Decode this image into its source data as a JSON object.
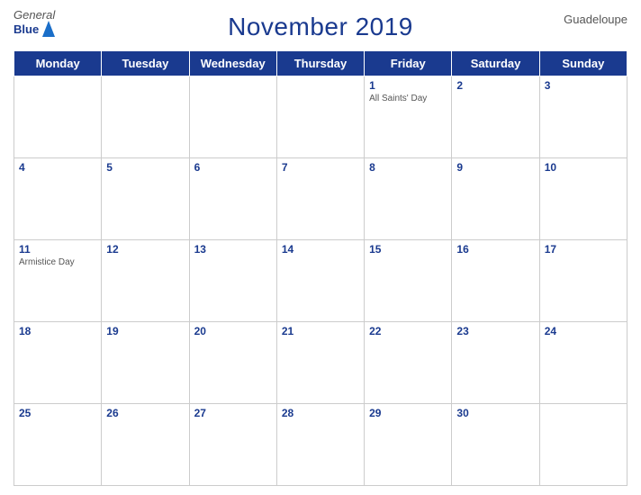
{
  "header": {
    "title": "November 2019",
    "country": "Guadeloupe",
    "logo_general": "General",
    "logo_blue": "Blue"
  },
  "days_of_week": [
    "Monday",
    "Tuesday",
    "Wednesday",
    "Thursday",
    "Friday",
    "Saturday",
    "Sunday"
  ],
  "weeks": [
    [
      {
        "date": "",
        "event": ""
      },
      {
        "date": "",
        "event": ""
      },
      {
        "date": "",
        "event": ""
      },
      {
        "date": "",
        "event": ""
      },
      {
        "date": "1",
        "event": "All Saints' Day"
      },
      {
        "date": "2",
        "event": ""
      },
      {
        "date": "3",
        "event": ""
      }
    ],
    [
      {
        "date": "4",
        "event": ""
      },
      {
        "date": "5",
        "event": ""
      },
      {
        "date": "6",
        "event": ""
      },
      {
        "date": "7",
        "event": ""
      },
      {
        "date": "8",
        "event": ""
      },
      {
        "date": "9",
        "event": ""
      },
      {
        "date": "10",
        "event": ""
      }
    ],
    [
      {
        "date": "11",
        "event": "Armistice Day"
      },
      {
        "date": "12",
        "event": ""
      },
      {
        "date": "13",
        "event": ""
      },
      {
        "date": "14",
        "event": ""
      },
      {
        "date": "15",
        "event": ""
      },
      {
        "date": "16",
        "event": ""
      },
      {
        "date": "17",
        "event": ""
      }
    ],
    [
      {
        "date": "18",
        "event": ""
      },
      {
        "date": "19",
        "event": ""
      },
      {
        "date": "20",
        "event": ""
      },
      {
        "date": "21",
        "event": ""
      },
      {
        "date": "22",
        "event": ""
      },
      {
        "date": "23",
        "event": ""
      },
      {
        "date": "24",
        "event": ""
      }
    ],
    [
      {
        "date": "25",
        "event": ""
      },
      {
        "date": "26",
        "event": ""
      },
      {
        "date": "27",
        "event": ""
      },
      {
        "date": "28",
        "event": ""
      },
      {
        "date": "29",
        "event": ""
      },
      {
        "date": "30",
        "event": ""
      },
      {
        "date": "",
        "event": ""
      }
    ]
  ]
}
